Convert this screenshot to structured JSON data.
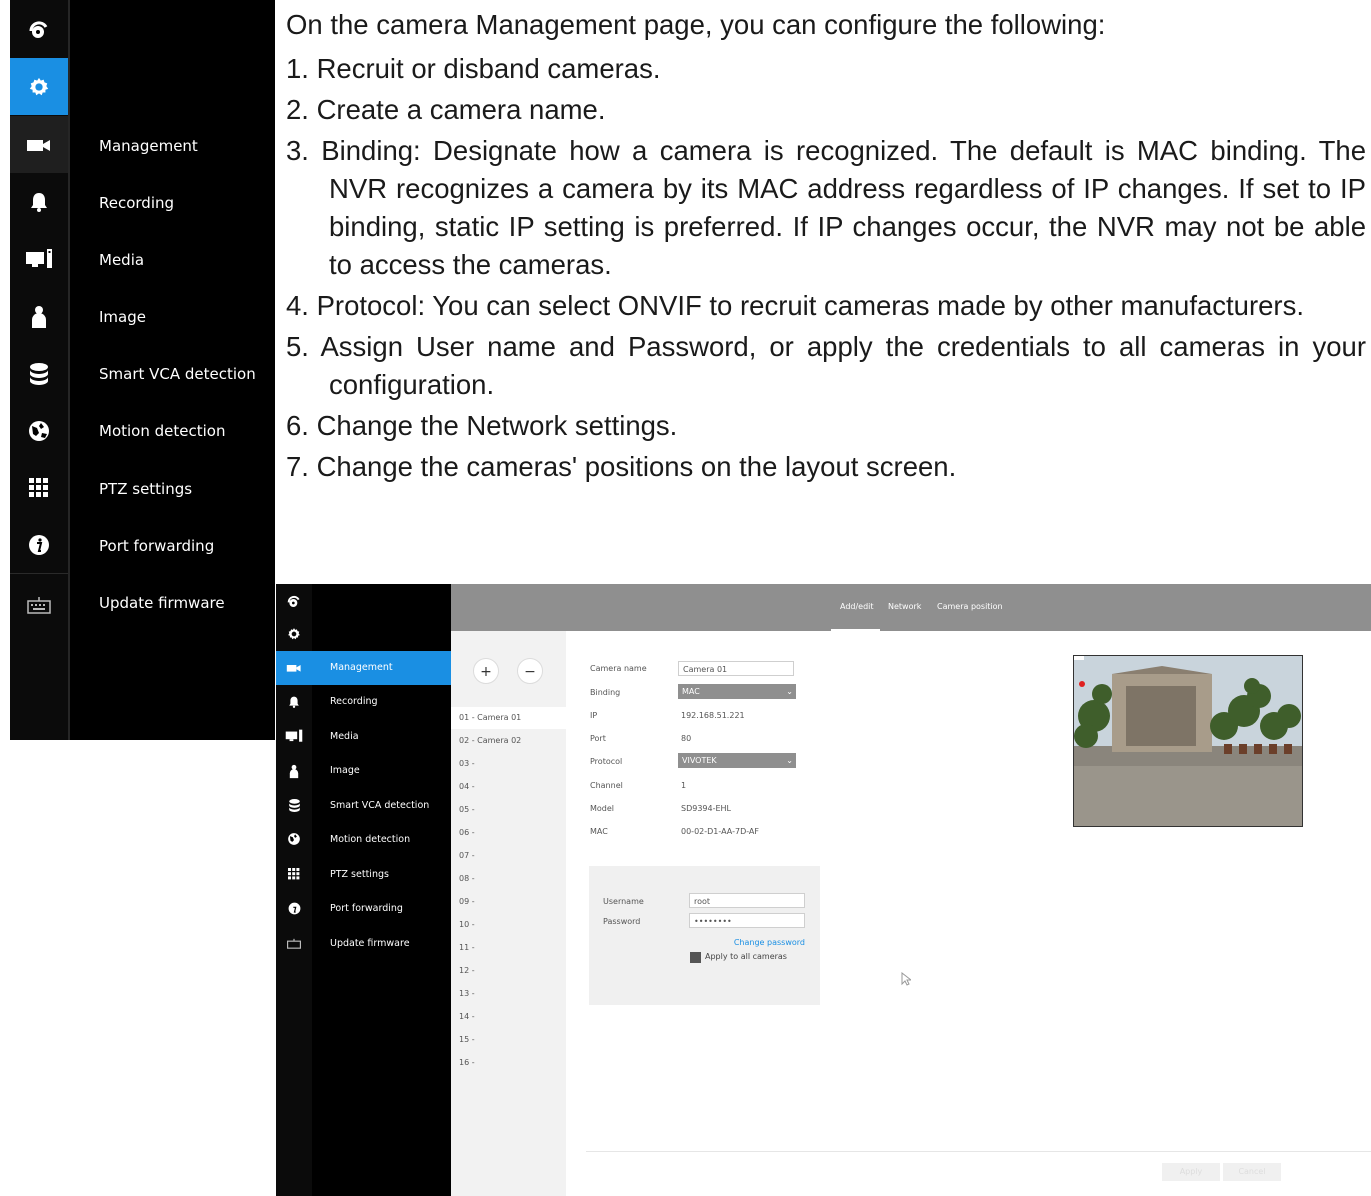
{
  "instructions": {
    "intro": "On the camera Management page, you can configure the following:",
    "items": [
      "1. Recruit or disband cameras.",
      "2. Create a camera name.",
      "3. Binding: Designate how a camera is recognized. The default is MAC binding. The NVR recognizes a camera by its MAC address regardless of IP changes. If set to IP binding, static IP setting is preferred. If IP changes occur, the NVR may not be able to access the cameras.",
      "4. Protocol: You can select ONVIF to recruit cameras made by other manufacturers.",
      "5. Assign User name and Password, or apply the credentials to all cameras in your configuration.",
      "6. Change the Network settings.",
      "7. Change the cameras' positions on the layout screen."
    ]
  },
  "sidebar": {
    "icons": [
      "logo-icon",
      "settings-icon",
      "camera-icon",
      "alert-icon",
      "monitor-icon",
      "user-icon",
      "storage-icon",
      "network-icon",
      "grid-icon",
      "info-icon",
      "keyboard-icon"
    ],
    "items": [
      {
        "label": "Management"
      },
      {
        "label": "Recording"
      },
      {
        "label": "Media"
      },
      {
        "label": "Image"
      },
      {
        "label": "Smart VCA detection"
      },
      {
        "label": "Motion detection"
      },
      {
        "label": "PTZ settings"
      },
      {
        "label": "Port forwarding"
      },
      {
        "label": "Update firmware"
      }
    ]
  },
  "tabs": [
    {
      "label": "Add/edit",
      "active": true
    },
    {
      "label": "Network"
    },
    {
      "label": "Camera position"
    }
  ],
  "camera_list": {
    "add_label": "+",
    "remove_label": "−",
    "items": [
      "01 - Camera 01",
      "02 - Camera 02",
      "03 -",
      "04 -",
      "05 -",
      "06 -",
      "07 -",
      "08 -",
      "09 -",
      "10 -",
      "11 -",
      "12 -",
      "13 -",
      "14 -",
      "15 -",
      "16 -"
    ]
  },
  "camera_form": {
    "camera_name_label": "Camera name",
    "camera_name_value": "Camera 01",
    "binding_label": "Binding",
    "binding_value": "MAC",
    "ip_label": "IP",
    "ip_value": "192.168.51.221",
    "port_label": "Port",
    "port_value": "80",
    "protocol_label": "Protocol",
    "protocol_value": "VIVOTEK",
    "channel_label": "Channel",
    "channel_value": "1",
    "model_label": "Model",
    "model_value": "SD9394-EHL",
    "mac_label": "MAC",
    "mac_value": "00-02-D1-AA-7D-AF"
  },
  "credentials": {
    "username_label": "Username",
    "username_value": "root",
    "password_label": "Password",
    "password_value": "••••••••",
    "change_password_label": "Change password",
    "apply_all_label": "Apply to all cameras"
  },
  "footer": {
    "apply_label": "Apply",
    "cancel_label": "Cancel"
  },
  "colors": {
    "accent": "#1a8fe3",
    "sidebar_bg": "#000000",
    "topbar_bg": "#8f8f8f"
  }
}
